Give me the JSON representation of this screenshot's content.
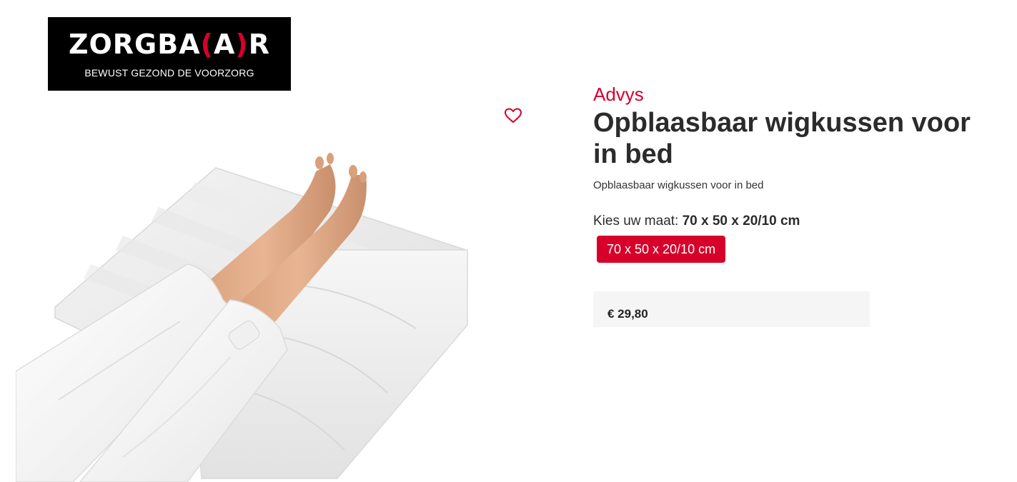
{
  "logo": {
    "name_part1": "ZORGBA",
    "name_accent_open": "(",
    "name_accent_letter": "A",
    "name_accent_close": ")",
    "name_part2": "R",
    "tagline": "BEWUST GEZOND DE VOORZORG"
  },
  "product": {
    "brand": "Advys",
    "title": "Opblaasbaar wigkussen voor in bed",
    "subtitle": "Opblaasbaar wigkussen voor in bed",
    "size_label": "Kies uw maat: ",
    "size_selected": "70 x 50 x 20/10 cm",
    "size_options": [
      "70 x 50 x 20/10 cm"
    ],
    "price": "€ 29,80"
  },
  "icons": {
    "wishlist": "heart-icon"
  },
  "colors": {
    "accent": "#d6002b",
    "logo_bg": "#000000",
    "price_box_bg": "#f5f5f5"
  }
}
